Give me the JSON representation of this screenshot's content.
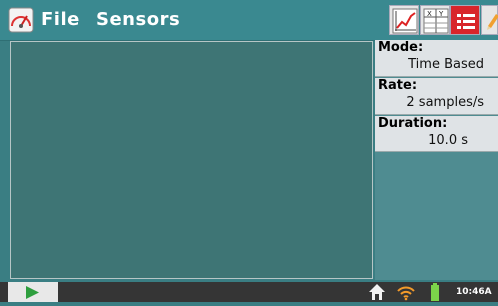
{
  "header": {
    "menu_file": "File",
    "menu_sensors": "Sensors"
  },
  "toolbar": {
    "graph_button_icon": "graph-view-icon",
    "table_button_icon": "table-view-icon",
    "meter_button_icon": "meter-view-icon",
    "notes_button_icon": "notes-pencil-icon"
  },
  "side_panel": {
    "mode_label": "Mode:",
    "mode_value": "Time Based",
    "rate_label": "Rate:",
    "rate_value": "2 samples/s",
    "duration_label": "Duration:",
    "duration_value": "10.0 s"
  },
  "statusbar": {
    "clock": "10:46A"
  },
  "colors": {
    "top_bar": "#3a8990",
    "main_area": "#3e7575",
    "side_panel": "#4f8c91",
    "field_bg": "#dfe3e6",
    "bottom_bar": "#353535",
    "play_green": "#2e9e3e"
  }
}
